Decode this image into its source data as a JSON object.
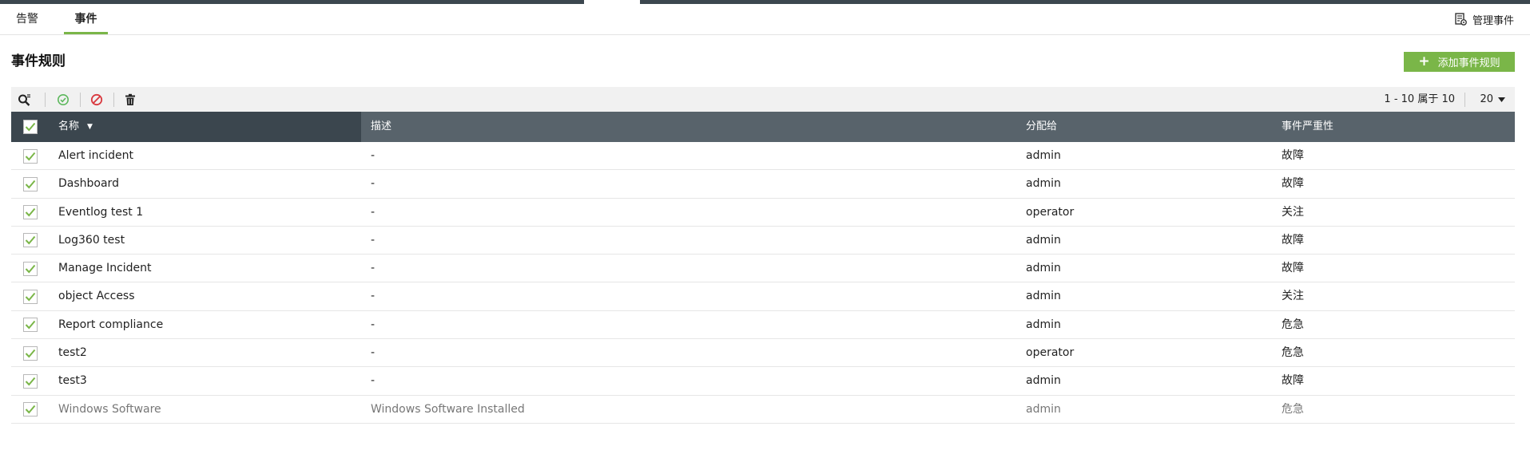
{
  "tabs": [
    {
      "label": "告警",
      "active": false
    },
    {
      "label": "事件",
      "active": true
    }
  ],
  "header": {
    "manage_events_label": "管理事件",
    "manage_events_icon": "document-gear-icon"
  },
  "page": {
    "title": "事件规则",
    "add_button_label": "添加事件规则",
    "add_button_icon": "plus-icon"
  },
  "toolbar": {
    "icons": [
      "search-filter-icon",
      "enable-icon",
      "disable-icon",
      "delete-icon"
    ],
    "pagination": "1 - 10 属于 10",
    "page_size": "20"
  },
  "table": {
    "columns": {
      "name": "名称",
      "description": "描述",
      "assigned_to": "分配给",
      "severity": "事件严重性"
    },
    "sort_indicator": "▼",
    "rows": [
      {
        "name": "Alert incident",
        "description": "-",
        "assigned_to": "admin",
        "severity": "故障"
      },
      {
        "name": "Dashboard",
        "description": "-",
        "assigned_to": "admin",
        "severity": "故障"
      },
      {
        "name": "Eventlog test 1",
        "description": "-",
        "assigned_to": "operator",
        "severity": "关注"
      },
      {
        "name": "Log360 test",
        "description": "-",
        "assigned_to": "admin",
        "severity": "故障"
      },
      {
        "name": "Manage Incident",
        "description": "-",
        "assigned_to": "admin",
        "severity": "故障"
      },
      {
        "name": "object Access",
        "description": "-",
        "assigned_to": "admin",
        "severity": "关注"
      },
      {
        "name": "Report compliance",
        "description": "-",
        "assigned_to": "admin",
        "severity": "危急"
      },
      {
        "name": "test2",
        "description": "-",
        "assigned_to": "operator",
        "severity": "危急"
      },
      {
        "name": "test3",
        "description": "-",
        "assigned_to": "admin",
        "severity": "故障"
      },
      {
        "name": "Windows Software",
        "description": "Windows Software Installed",
        "assigned_to": "admin",
        "severity": "危急"
      }
    ]
  },
  "colors": {
    "accent_green": "#7ab648",
    "header_dark": "#3b464e",
    "header_mid": "#58636b",
    "enable_green": "#5cb85c",
    "disable_red": "#d9393f"
  }
}
